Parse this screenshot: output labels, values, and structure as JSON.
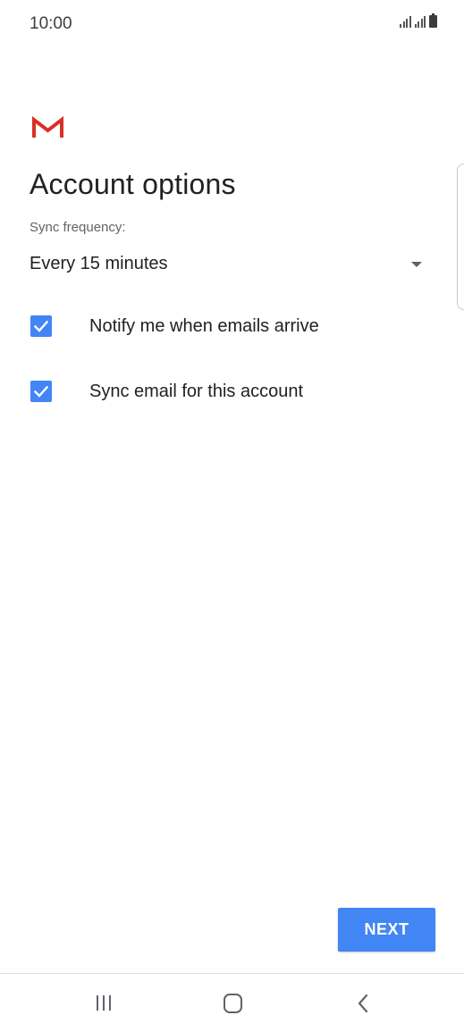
{
  "status_bar": {
    "time": "10:00",
    "icons": [
      "signal-icon",
      "signal-icon",
      "battery-icon"
    ]
  },
  "app": {
    "logo": "gmail-logo-icon",
    "title": "Account options"
  },
  "sync": {
    "label": "Sync frequency:",
    "selected_value": "Every 15 minutes"
  },
  "options": {
    "notify": {
      "label": "Notify me when emails arrive",
      "checked": true
    },
    "sync_email": {
      "label": "Sync email for this account",
      "checked": true
    }
  },
  "actions": {
    "next_label": "NEXT"
  },
  "colors": {
    "accent": "#4285f4",
    "gmail_red": "#d93025"
  },
  "nav_bar": {
    "buttons": [
      "recent-apps-icon",
      "home-icon",
      "back-icon"
    ]
  }
}
